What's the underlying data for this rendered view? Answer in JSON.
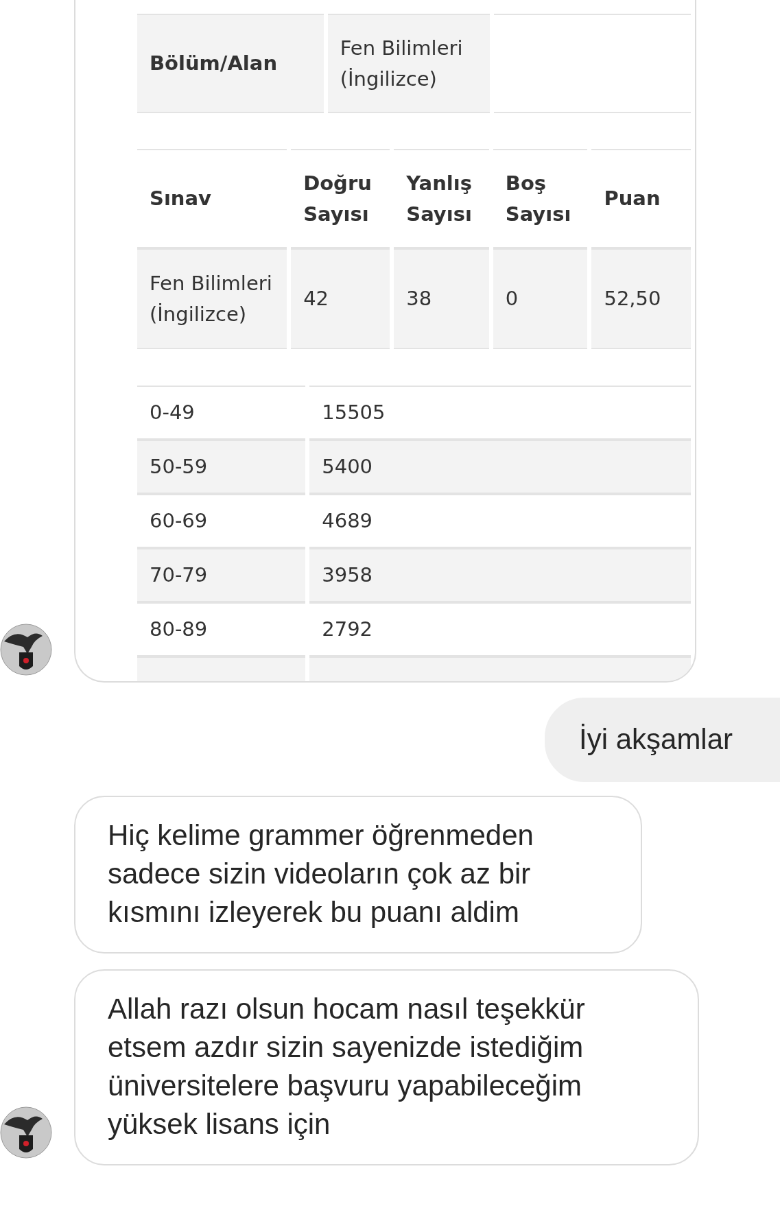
{
  "messages": [
    {
      "kind": "image",
      "outgoing": false,
      "avatar": true,
      "screenshot": {
        "info_table": {
          "label": "Bölüm/Alan",
          "value": "Fen Bilimleri (İngilizce)"
        },
        "result_table": {
          "columns": [
            "Sınav",
            "Doğru Sayısı",
            "Yanlış Sayısı",
            "Boş Sayısı",
            "Puan"
          ],
          "rows": [
            [
              "Fen Bilimleri (İngilizce)",
              "42",
              "38",
              "0",
              "52,50"
            ]
          ]
        },
        "distribution_table": {
          "rows": [
            [
              "0-49",
              "15505"
            ],
            [
              "50-59",
              "5400"
            ],
            [
              "60-69",
              "4689"
            ],
            [
              "70-79",
              "3958"
            ],
            [
              "80-89",
              "2792"
            ]
          ]
        }
      }
    },
    {
      "kind": "text",
      "outgoing": true,
      "text": "İyi akşamlar"
    },
    {
      "kind": "text",
      "outgoing": false,
      "avatar": false,
      "text": "Hiç kelime grammer öğrenmeden sadece sizin videoların çok az bir kısmını izleyerek bu puanı aldim"
    },
    {
      "kind": "text",
      "outgoing": false,
      "avatar": true,
      "text": "Allah razı olsun hocam nasıl teşekkür etsem azdır sizin sayenizde istediğim üniversitelere başvuru yapabileceğim yüksek lisans için"
    }
  ]
}
